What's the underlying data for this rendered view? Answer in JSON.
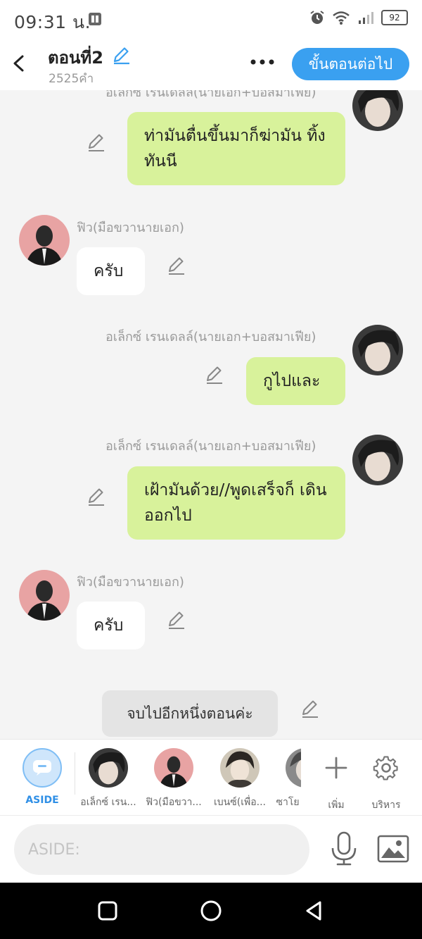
{
  "status_bar": {
    "time": "09:31 น.",
    "battery": "92"
  },
  "header": {
    "title": "ตอนที่2",
    "word_count": "2525คำ",
    "next_button": "ขั้นตอนต่อไป"
  },
  "messages": [
    {
      "side": "right",
      "speaker": "อเล็กซ์ เรนเดลล์(นายเอก+บอสมาเฟีย)",
      "text": "ท่ามันตื่นขึ้นมาก็ฆ่ามัน ทิ้งทันนี"
    },
    {
      "side": "left",
      "speaker": "ฟิว(มือขวานายเอก)",
      "text": "ครับ"
    },
    {
      "side": "right",
      "speaker": "อเล็กซ์ เรนเดลล์(นายเอก+บอสมาเฟีย)",
      "text": "กูไปและ"
    },
    {
      "side": "right",
      "speaker": "อเล็กซ์ เรนเดลล์(นายเอก+บอสมาเฟีย)",
      "text": "เฝ้ามันด้วย//พูดเสร็จก็ เดินออกไป"
    },
    {
      "side": "left",
      "speaker": "ฟิว(มือขวานายเอก)",
      "text": "ครับ"
    }
  ],
  "system_message": "จบไปอีกหนึ่งตอนค่ะ",
  "characters": {
    "aside": "ASIDE",
    "list": [
      "อเล็กซ์ เรน...",
      "ฟิว(มือขวา...",
      "เบนซ์(เพื่อ...",
      "ซาโย"
    ],
    "add": "เพิ่ม",
    "manage": "บริหาร"
  },
  "input": {
    "placeholder": "ASIDE:"
  },
  "colors": {
    "accent": "#3aa0f0",
    "bubble_right": "#d8f29b",
    "bubble_left": "#ffffff",
    "background": "#f4f4f4"
  }
}
